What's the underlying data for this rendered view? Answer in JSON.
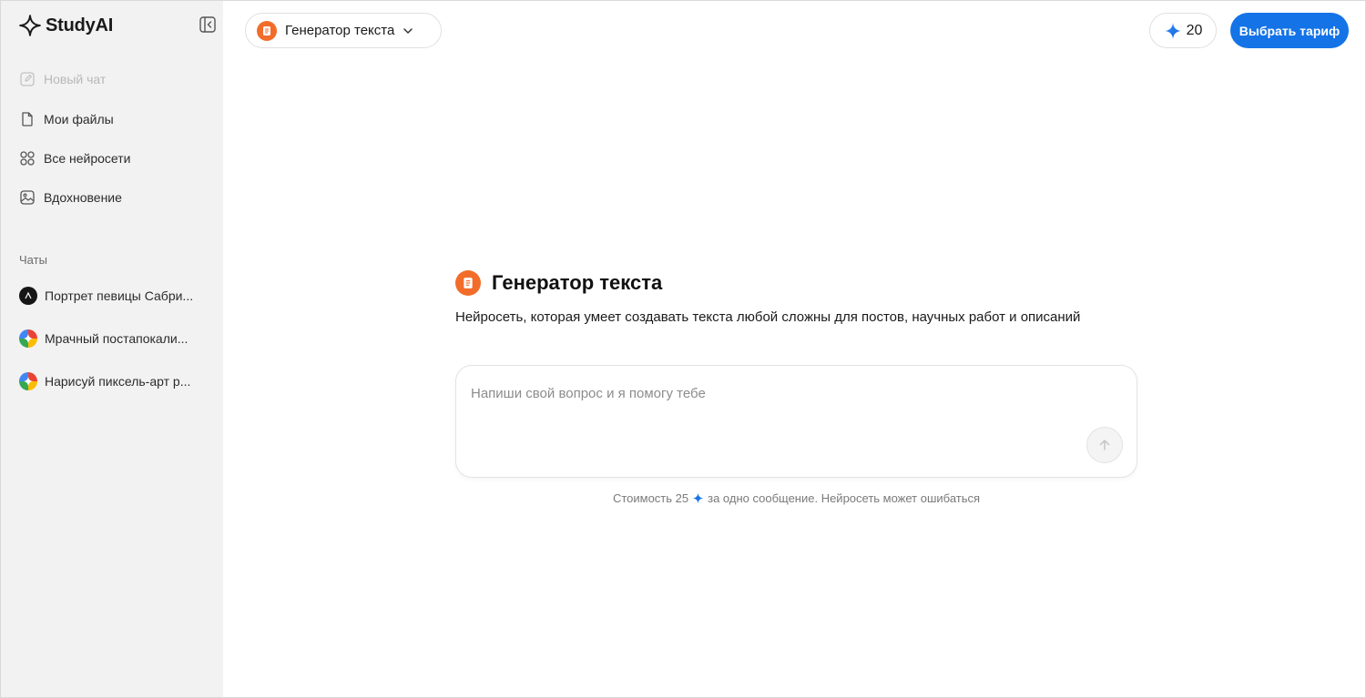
{
  "app": {
    "name": "StudyAI"
  },
  "sidebar": {
    "nav": [
      {
        "label": "Новый чат",
        "icon": "edit-icon",
        "disabled": true
      },
      {
        "label": "Мои файлы",
        "icon": "file-icon"
      },
      {
        "label": "Все нейросети",
        "icon": "grid-icon"
      },
      {
        "label": "Вдохновение",
        "icon": "image-icon"
      }
    ],
    "chats_title": "Чаты",
    "chats": [
      {
        "label": "Портрет певицы Сабри...",
        "avatar": "dark-model-icon"
      },
      {
        "label": "Мрачный постапокали...",
        "avatar": "multicolor-model-icon"
      },
      {
        "label": "Нарисуй пиксель-арт р...",
        "avatar": "multicolor-model-icon"
      }
    ]
  },
  "header": {
    "model_selector": {
      "label": "Генератор текста"
    },
    "credits": {
      "value": "20"
    },
    "plan_button": "Выбрать тариф"
  },
  "main": {
    "title": "Генератор текста",
    "description": "Нейросеть, которая умеет создавать текста любой сложны для постов, научных работ и описаний",
    "input": {
      "placeholder": "Напиши свой вопрос и я помогу тебе",
      "value": ""
    },
    "footnote": {
      "before": "Стоимость 25",
      "after": "за одно сообщение. Нейросеть может ошибаться"
    }
  },
  "colors": {
    "accent": "#1473e6",
    "badge": "#f26d2a",
    "sidebar_bg": "#f2f2f2"
  }
}
